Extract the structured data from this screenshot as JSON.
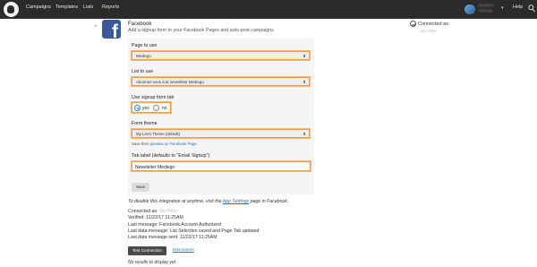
{
  "nav": {
    "links": [
      "Campaigns",
      "Templates",
      "Lists",
      "Reports"
    ],
    "account_line1": "Benjamin",
    "account_line2": "Mediego",
    "help": "Help"
  },
  "integration": {
    "title": "Facebook",
    "description": "Add a signup form to your Facebook Pages and auto-post campaigns",
    "connected_label": "Connected as",
    "connected_user": "Ido Pilon"
  },
  "form": {
    "page_label": "Page to use",
    "page_value": "Mediego",
    "list_label": "List to use",
    "list_value": "Abonnez-vous à la newsletter Mediego",
    "tab_label": "Use signup form tab",
    "radio_yes": "yes",
    "radio_no": "no",
    "theme_label": "Form theme",
    "theme_value": "My List's Theme (default)",
    "help_prefix": "Save then",
    "help_link": "preview on Facebook Page.",
    "tab_name_label": "Tab label (defaults to \"Email Signup\")",
    "tab_name_value": "Newsletter Mediego",
    "save": "Save"
  },
  "footer": {
    "disable_prefix": "To disable this integration at anytime, visit the",
    "disable_link": "App Settings",
    "disable_suffix": "page in Facebook.",
    "connected_as_label": "Connected as:",
    "connected_as_value": "Ido Pilon",
    "verified": "Verified: 11/22/17 11:25AM",
    "last_message": "Last message: Facebook Account Authorized",
    "last_data_message": "Last data message: List Selection saved and Page Tab updated",
    "last_data_sent": "Last data message sent: 11/22/17 11:25AM",
    "test_connection": "Test Connection",
    "disconnect": "Disconnect",
    "no_results": "No results to display yet"
  },
  "colors": {
    "nav_bg": "#2b2b2b",
    "facebook_blue": "#3b5998",
    "highlight_orange": "#f59a3e",
    "link_blue": "#2a6fb0"
  }
}
